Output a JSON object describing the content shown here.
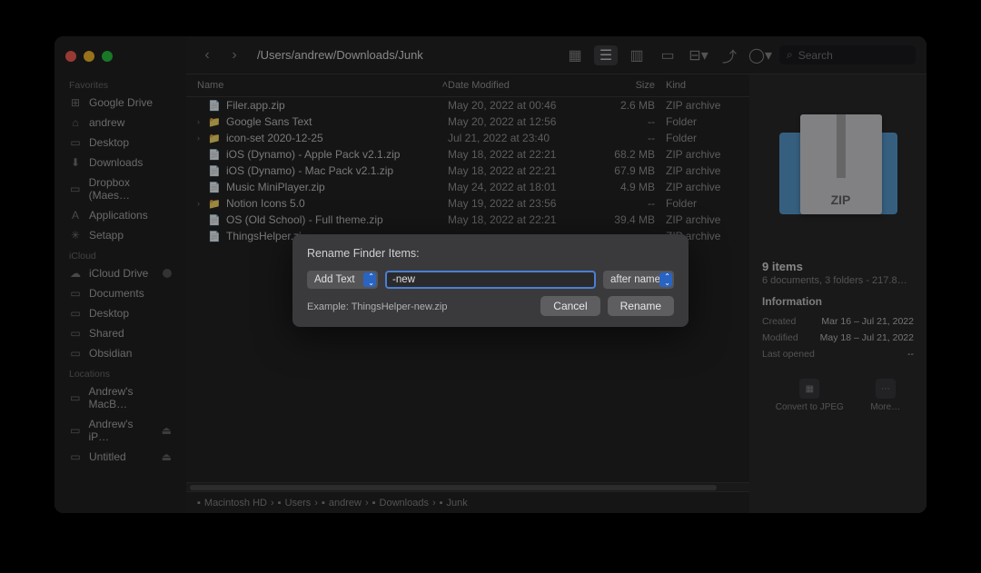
{
  "path": "/Users/andrew/Downloads/Junk",
  "search_placeholder": "Search",
  "sidebar": {
    "sections": [
      {
        "title": "Favorites",
        "items": [
          {
            "icon": "⊞",
            "label": "Google Drive"
          },
          {
            "icon": "⌂",
            "label": "andrew"
          },
          {
            "icon": "▭",
            "label": "Desktop"
          },
          {
            "icon": "⬇",
            "label": "Downloads"
          },
          {
            "icon": "▭",
            "label": "Dropbox (Maes…"
          },
          {
            "icon": "A",
            "label": "Applications"
          },
          {
            "icon": "✳",
            "label": "Setapp"
          }
        ]
      },
      {
        "title": "iCloud",
        "items": [
          {
            "icon": "☁",
            "label": "iCloud Drive",
            "badge": true
          },
          {
            "icon": "▭",
            "label": "Documents"
          },
          {
            "icon": "▭",
            "label": "Desktop"
          },
          {
            "icon": "▭",
            "label": "Shared"
          },
          {
            "icon": "▭",
            "label": "Obsidian"
          }
        ]
      },
      {
        "title": "Locations",
        "items": [
          {
            "icon": "▭",
            "label": "Andrew's MacB…"
          },
          {
            "icon": "▭",
            "label": "Andrew's iP…",
            "eject": true
          },
          {
            "icon": "▭",
            "label": "Untitled",
            "eject": true
          }
        ]
      }
    ]
  },
  "columns": {
    "name": "Name",
    "date": "Date Modified",
    "size": "Size",
    "kind": "Kind"
  },
  "files": [
    {
      "exp": "",
      "icon": "📄",
      "name": "Filer.app.zip",
      "date": "May 20, 2022 at 00:46",
      "size": "2.6 MB",
      "kind": "ZIP archive"
    },
    {
      "exp": "›",
      "icon": "📁",
      "name": "Google Sans Text",
      "date": "May 20, 2022 at 12:56",
      "size": "--",
      "kind": "Folder"
    },
    {
      "exp": "›",
      "icon": "📁",
      "name": "icon-set 2020-12-25",
      "date": "Jul 21, 2022 at 23:40",
      "size": "--",
      "kind": "Folder"
    },
    {
      "exp": "",
      "icon": "📄",
      "name": "iOS (Dynamo) - Apple Pack v2.1.zip",
      "date": "May 18, 2022 at 22:21",
      "size": "68.2 MB",
      "kind": "ZIP archive"
    },
    {
      "exp": "",
      "icon": "📄",
      "name": "iOS (Dynamo) - Mac Pack v2.1.zip",
      "date": "May 18, 2022 at 22:21",
      "size": "67.9 MB",
      "kind": "ZIP archive"
    },
    {
      "exp": "",
      "icon": "📄",
      "name": "Music MiniPlayer.zip",
      "date": "May 24, 2022 at 18:01",
      "size": "4.9 MB",
      "kind": "ZIP archive"
    },
    {
      "exp": "›",
      "icon": "📁",
      "name": "Notion Icons 5.0",
      "date": "May 19, 2022 at 23:56",
      "size": "--",
      "kind": "Folder"
    },
    {
      "exp": "",
      "icon": "📄",
      "name": "OS (Old School) - Full theme.zip",
      "date": "May 18, 2022 at 22:21",
      "size": "39.4 MB",
      "kind": "ZIP archive"
    },
    {
      "exp": "",
      "icon": "📄",
      "name": "ThingsHelper.zi",
      "date": "",
      "size": "",
      "kind": "ZIP archive"
    }
  ],
  "breadcrumbs": [
    "Macintosh HD",
    "Users",
    "andrew",
    "Downloads",
    "Junk"
  ],
  "info": {
    "zip_label": "ZIP",
    "title": "9 items",
    "subtitle": "6 documents, 3 folders - 217.8…",
    "section": "Information",
    "created_k": "Created",
    "created_v": "Mar 16 – Jul 21, 2022",
    "modified_k": "Modified",
    "modified_v": "May 18 – Jul 21, 2022",
    "opened_k": "Last opened",
    "opened_v": "--",
    "act1": "Convert to JPEG",
    "act2": "More…"
  },
  "dialog": {
    "title": "Rename Finder Items:",
    "mode": "Add Text",
    "input_value": "-new",
    "position": "after name",
    "example": "Example: ThingsHelper-new.zip",
    "cancel": "Cancel",
    "rename": "Rename"
  }
}
